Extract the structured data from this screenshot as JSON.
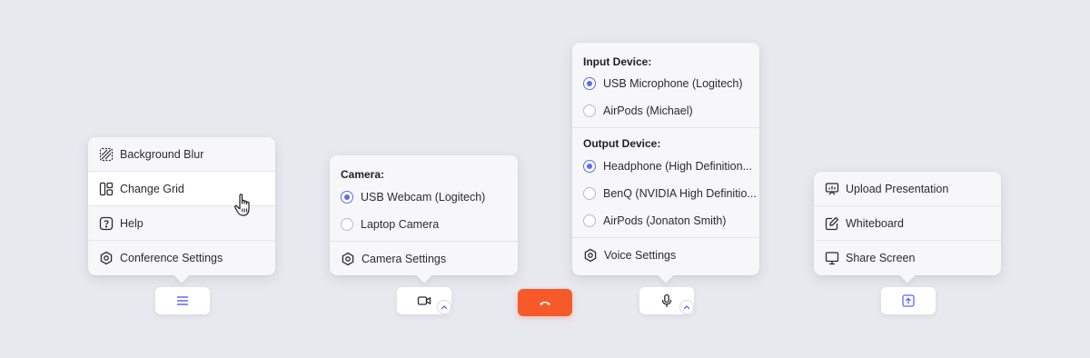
{
  "menu_popover": {
    "items": [
      {
        "label": "Background Blur",
        "icon": "background-blur-icon"
      },
      {
        "label": "Change Grid",
        "icon": "grid-icon"
      },
      {
        "label": "Help",
        "icon": "help-icon"
      },
      {
        "label": "Conference Settings",
        "icon": "settings-icon"
      }
    ]
  },
  "camera_popover": {
    "title": "Camera:",
    "options": [
      {
        "label": "USB Webcam (Logitech)",
        "selected": true
      },
      {
        "label": "Laptop Camera",
        "selected": false
      }
    ],
    "settings_label": "Camera Settings"
  },
  "audio_popover": {
    "input_title": "Input Device:",
    "input_options": [
      {
        "label": "USB Microphone (Logitech)",
        "selected": true
      },
      {
        "label": "AirPods (Michael)",
        "selected": false
      }
    ],
    "output_title": "Output Device:",
    "output_options": [
      {
        "label": "Headphone (High Definition...",
        "selected": true
      },
      {
        "label": "BenQ (NVIDIA High Definitio...",
        "selected": false
      },
      {
        "label": "AirPods (Jonaton Smith)",
        "selected": false
      }
    ],
    "settings_label": "Voice Settings"
  },
  "share_popover": {
    "items": [
      {
        "label": "Upload Presentation",
        "icon": "presentation-icon"
      },
      {
        "label": "Whiteboard",
        "icon": "whiteboard-icon"
      },
      {
        "label": "Share Screen",
        "icon": "monitor-icon"
      }
    ]
  },
  "colors": {
    "background": "#e8e8ef",
    "accent": "#5b6cf0",
    "end_call": "#f65a2a"
  }
}
